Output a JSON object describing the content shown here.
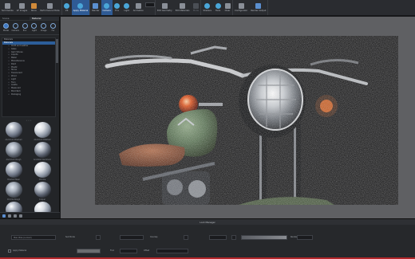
{
  "colors": {
    "accent": "#2f5b95",
    "viewport_bg": "#5f6063",
    "status_red": "#b3262a"
  },
  "toolbar": {
    "buttons": [
      {
        "label": "Summarize",
        "icon": "gear-icon"
      },
      {
        "label": "AF Images",
        "icon": "image-icon"
      },
      {
        "label": "Store",
        "icon": "store-icon"
      },
      {
        "label": "Performance Mode",
        "icon": "dashboard-icon"
      },
      {
        "label": "VR",
        "icon": "vr-icon"
      },
      {
        "label": "Apply Material",
        "icon": "brush-icon"
      },
      {
        "label": "Render",
        "icon": "render-icon"
      },
      {
        "label": "Camera",
        "icon": "camera-icon"
      },
      {
        "label": "Env",
        "icon": "environment-icon"
      },
      {
        "label": "Light",
        "icon": "light-icon"
      },
      {
        "label": "Animation",
        "icon": "animation-icon"
      },
      {
        "label": "Edit Geometry",
        "icon": "geometry-icon"
      },
      {
        "label": "Edit Materials",
        "icon": "material-icon"
      },
      {
        "label": "Mode",
        "icon": "mode-icon"
      },
      {
        "label": "Shaders",
        "icon": "shader-icon"
      },
      {
        "label": "Tools",
        "icon": "tools-icon"
      },
      {
        "label": "Clear",
        "icon": "clear-icon"
      },
      {
        "label": "Configurator",
        "icon": "configurator-icon"
      },
      {
        "label": "Render Output",
        "icon": "output-icon"
      }
    ]
  },
  "left_panel": {
    "tabs": [
      "Scene",
      "Material"
    ],
    "icons": [
      {
        "label": "Model",
        "icon": "cube-icon"
      },
      {
        "label": "Camera",
        "icon": "camera-icon"
      },
      {
        "label": "Env",
        "icon": "globe-icon"
      },
      {
        "label": "Light",
        "icon": "bulb-icon"
      },
      {
        "label": "Image",
        "icon": "image-icon"
      },
      {
        "label": "Fur",
        "icon": "fur-icon"
      }
    ],
    "tree": [
      {
        "label": "Materials",
        "selected": false,
        "child": false
      },
      {
        "label": "Materials",
        "selected": true,
        "child": false
      },
      {
        "label": "Cloth and Leather",
        "selected": false,
        "child": true
      },
      {
        "label": "Glass",
        "selected": false,
        "child": true
      },
      {
        "label": "Gem Stones",
        "selected": false,
        "child": true
      },
      {
        "label": "Liquids",
        "selected": false,
        "child": true
      },
      {
        "label": "Metal",
        "selected": false,
        "child": true
      },
      {
        "label": "Miscellaneous",
        "selected": false,
        "child": true
      },
      {
        "label": "Paint",
        "selected": false,
        "child": true
      },
      {
        "label": "Plastic",
        "selected": false,
        "child": true
      },
      {
        "label": "Stone",
        "selected": false,
        "child": true
      },
      {
        "label": "Translucent",
        "selected": false,
        "child": true
      },
      {
        "label": "Wood",
        "selected": false,
        "child": true
      },
      {
        "label": "Light",
        "selected": false,
        "child": true
      },
      {
        "label": "Toon",
        "selected": false,
        "child": true
      },
      {
        "label": "Axalta",
        "selected": false,
        "child": true
      },
      {
        "label": "Measured",
        "selected": false,
        "child": true
      },
      {
        "label": "Mold-Tech",
        "selected": false,
        "child": true
      },
      {
        "label": "Packaging",
        "selected": false,
        "child": true
      }
    ],
    "divider": "• • •",
    "materials": [
      {
        "label": "Aluminum Brushed"
      },
      {
        "label": "Aluminum Polished"
      },
      {
        "label": "Aluminum Rough"
      },
      {
        "label": "Anodized Aluminum"
      },
      {
        "label": "Brushed Steel"
      },
      {
        "label": "Chrome"
      },
      {
        "label": "Chrome Rough"
      },
      {
        "label": "Copper"
      },
      {
        "label": "Gold Polished"
      },
      {
        "label": "Metal Flake"
      },
      {
        "label": "Silver"
      },
      {
        "label": "Steel Rough"
      }
    ]
  },
  "bottom": {
    "title": "Lock Manager",
    "row1": {
      "field_value": "Main Bike (Locked)",
      "label_a": "Sub Mode",
      "label_b": "Overlap",
      "label_c": "Render Stats"
    },
    "row2": {
      "check_label": "Apply Material",
      "field_a_label": "Find",
      "field_b_label": "Offset"
    }
  }
}
